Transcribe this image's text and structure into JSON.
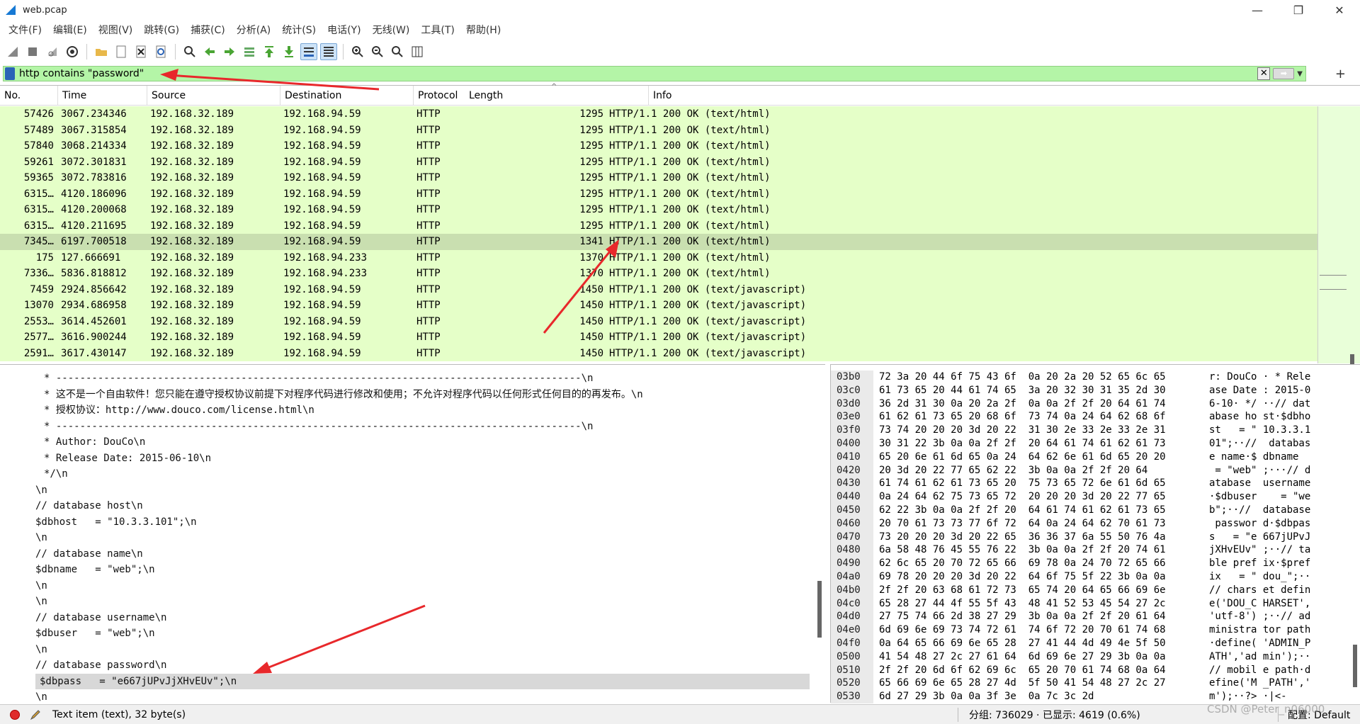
{
  "window": {
    "title": "web.pcap",
    "minimize": "—",
    "maximize": "❐",
    "close": "✕"
  },
  "menu": [
    "文件(F)",
    "编辑(E)",
    "视图(V)",
    "跳转(G)",
    "捕获(C)",
    "分析(A)",
    "统计(S)",
    "电话(Y)",
    "无线(W)",
    "工具(T)",
    "帮助(H)"
  ],
  "filter": {
    "value": "http contains \"password\""
  },
  "columns": [
    "No.",
    "Time",
    "Source",
    "Destination",
    "Protocol",
    "Length",
    "Info"
  ],
  "packets": [
    {
      "no": "57426",
      "time": "3067.234346",
      "src": "192.168.32.189",
      "dst": "192.168.94.59",
      "proto": "HTTP",
      "len": "1295",
      "info": "HTTP/1.1 200 OK  (text/html)"
    },
    {
      "no": "57489",
      "time": "3067.315854",
      "src": "192.168.32.189",
      "dst": "192.168.94.59",
      "proto": "HTTP",
      "len": "1295",
      "info": "HTTP/1.1 200 OK  (text/html)"
    },
    {
      "no": "57840",
      "time": "3068.214334",
      "src": "192.168.32.189",
      "dst": "192.168.94.59",
      "proto": "HTTP",
      "len": "1295",
      "info": "HTTP/1.1 200 OK  (text/html)"
    },
    {
      "no": "59261",
      "time": "3072.301831",
      "src": "192.168.32.189",
      "dst": "192.168.94.59",
      "proto": "HTTP",
      "len": "1295",
      "info": "HTTP/1.1 200 OK  (text/html)"
    },
    {
      "no": "59365",
      "time": "3072.783816",
      "src": "192.168.32.189",
      "dst": "192.168.94.59",
      "proto": "HTTP",
      "len": "1295",
      "info": "HTTP/1.1 200 OK  (text/html)"
    },
    {
      "no": "6315…",
      "time": "4120.186096",
      "src": "192.168.32.189",
      "dst": "192.168.94.59",
      "proto": "HTTP",
      "len": "1295",
      "info": "HTTP/1.1 200 OK  (text/html)"
    },
    {
      "no": "6315…",
      "time": "4120.200068",
      "src": "192.168.32.189",
      "dst": "192.168.94.59",
      "proto": "HTTP",
      "len": "1295",
      "info": "HTTP/1.1 200 OK  (text/html)"
    },
    {
      "no": "6315…",
      "time": "4120.211695",
      "src": "192.168.32.189",
      "dst": "192.168.94.59",
      "proto": "HTTP",
      "len": "1295",
      "info": "HTTP/1.1 200 OK  (text/html)"
    },
    {
      "no": "7345…",
      "time": "6197.700518",
      "src": "192.168.32.189",
      "dst": "192.168.94.59",
      "proto": "HTTP",
      "len": "1341",
      "info": "HTTP/1.1 200 OK  (text/html)",
      "selected": true
    },
    {
      "no": "175",
      "time": "127.666691",
      "src": "192.168.32.189",
      "dst": "192.168.94.233",
      "proto": "HTTP",
      "len": "1370",
      "info": "HTTP/1.1 200 OK  (text/html)"
    },
    {
      "no": "7336…",
      "time": "5836.818812",
      "src": "192.168.32.189",
      "dst": "192.168.94.233",
      "proto": "HTTP",
      "len": "1370",
      "info": "HTTP/1.1 200 OK  (text/html)"
    },
    {
      "no": "7459",
      "time": "2924.856642",
      "src": "192.168.32.189",
      "dst": "192.168.94.59",
      "proto": "HTTP",
      "len": "1450",
      "info": "HTTP/1.1 200 OK  (text/javascript)"
    },
    {
      "no": "13070",
      "time": "2934.686958",
      "src": "192.168.32.189",
      "dst": "192.168.94.59",
      "proto": "HTTP",
      "len": "1450",
      "info": "HTTP/1.1 200 OK  (text/javascript)"
    },
    {
      "no": "2553…",
      "time": "3614.452601",
      "src": "192.168.32.189",
      "dst": "192.168.94.59",
      "proto": "HTTP",
      "len": "1450",
      "info": "HTTP/1.1 200 OK  (text/javascript)"
    },
    {
      "no": "2577…",
      "time": "3616.900244",
      "src": "192.168.32.189",
      "dst": "192.168.94.59",
      "proto": "HTTP",
      "len": "1450",
      "info": "HTTP/1.1 200 OK  (text/javascript)"
    },
    {
      "no": "2591…",
      "time": "3617.430147",
      "src": "192.168.32.189",
      "dst": "192.168.94.59",
      "proto": "HTTP",
      "len": "1450",
      "info": "HTTP/1.1 200 OK  (text/javascript)"
    }
  ],
  "details": [
    {
      "text": "* ----------------------------------------------------------------------------------------\\n"
    },
    {
      "text": "* 这不是一个自由软件！您只能在遵守授权协议前提下对程序代码进行修改和使用；不允许对程序代码以任何形式任何目的的再发布。\\n"
    },
    {
      "text": "* 授权协议：http://www.douco.com/license.html\\n"
    },
    {
      "text": "* ----------------------------------------------------------------------------------------\\n"
    },
    {
      "text": "* Author: DouCo\\n"
    },
    {
      "text": "* Release Date: 2015-06-10\\n"
    },
    {
      "text": "*/\\n"
    },
    {
      "text": "\\n",
      "indent": true
    },
    {
      "text": "// database host\\n",
      "indent": true
    },
    {
      "text": "$dbhost   = \"10.3.3.101\";\\n",
      "indent": true
    },
    {
      "text": "\\n",
      "indent": true
    },
    {
      "text": "// database name\\n",
      "indent": true
    },
    {
      "text": "$dbname   = \"web\";\\n",
      "indent": true
    },
    {
      "text": "\\n",
      "indent": true
    },
    {
      "text": "\\n",
      "indent": true
    },
    {
      "text": "// database username\\n",
      "indent": true
    },
    {
      "text": "$dbuser   = \"web\";\\n",
      "indent": true
    },
    {
      "text": "\\n",
      "indent": true
    },
    {
      "text": "// database password\\n",
      "indent": true
    },
    {
      "text": "$dbpass   = \"e667jUPvJjXHvEUv\";\\n",
      "indent": true,
      "highlight": true
    },
    {
      "text": "\\n",
      "indent": true
    }
  ],
  "hex": [
    {
      "off": "03b0",
      "bytes": "72 3a 20 44 6f 75 43 6f  0a 20 2a 20 52 65 6c 65",
      "ascii": "r: DouCo · * Rele"
    },
    {
      "off": "03c0",
      "bytes": "61 73 65 20 44 61 74 65  3a 20 32 30 31 35 2d 30",
      "ascii": "ase Date : 2015-0"
    },
    {
      "off": "03d0",
      "bytes": "36 2d 31 30 0a 20 2a 2f  0a 0a 2f 2f 20 64 61 74",
      "ascii": "6-10· */ ··// dat"
    },
    {
      "off": "03e0",
      "bytes": "61 62 61 73 65 20 68 6f  73 74 0a 24 64 62 68 6f",
      "ascii": "abase ho st·$dbho"
    },
    {
      "off": "03f0",
      "bytes": "73 74 20 20 20 3d 20 22  31 30 2e 33 2e 33 2e 31",
      "ascii": "st   = \" 10.3.3.1"
    },
    {
      "off": "0400",
      "bytes": "30 31 22 3b 0a 0a 2f 2f  20 64 61 74 61 62 61 73",
      "ascii": "01\";··//  databas"
    },
    {
      "off": "0410",
      "bytes": "65 20 6e 61 6d 65 0a 24  64 62 6e 61 6d 65 20 20",
      "ascii": "e name·$ dbname  "
    },
    {
      "off": "0420",
      "bytes": "20 3d 20 22 77 65 62 22  3b 0a 0a 2f 2f 20 64",
      "ascii": " = \"web\" ;···// d"
    },
    {
      "off": "0430",
      "bytes": "61 74 61 62 61 73 65 20  75 73 65 72 6e 61 6d 65",
      "ascii": "atabase  username"
    },
    {
      "off": "0440",
      "bytes": "0a 24 64 62 75 73 65 72  20 20 20 3d 20 22 77 65",
      "ascii": "·$dbuser    = \"we"
    },
    {
      "off": "0450",
      "bytes": "62 22 3b 0a 0a 2f 2f 20  64 61 74 61 62 61 73 65",
      "ascii": "b\";··//  database"
    },
    {
      "off": "0460",
      "bytes": "20 70 61 73 73 77 6f 72  64 0a 24 64 62 70 61 73",
      "ascii": " passwor d·$dbpas"
    },
    {
      "off": "0470",
      "bytes": "73 20 20 20 3d 20 22 65  36 36 37 6a 55 50 76 4a",
      "ascii": "s   = \"e 667jUPvJ"
    },
    {
      "off": "0480",
      "bytes": "6a 58 48 76 45 55 76 22  3b 0a 0a 2f 2f 20 74 61",
      "ascii": "jXHvEUv\" ;··// ta"
    },
    {
      "off": "0490",
      "bytes": "62 6c 65 20 70 72 65 66  69 78 0a 24 70 72 65 66",
      "ascii": "ble pref ix·$pref"
    },
    {
      "off": "04a0",
      "bytes": "69 78 20 20 20 3d 20 22  64 6f 75 5f 22 3b 0a 0a",
      "ascii": "ix   = \" dou_\";··"
    },
    {
      "off": "04b0",
      "bytes": "2f 2f 20 63 68 61 72 73  65 74 20 64 65 66 69 6e",
      "ascii": "// chars et defin"
    },
    {
      "off": "04c0",
      "bytes": "65 28 27 44 4f 55 5f 43  48 41 52 53 45 54 27 2c",
      "ascii": "e('DOU_C HARSET',"
    },
    {
      "off": "04d0",
      "bytes": "27 75 74 66 2d 38 27 29  3b 0a 0a 2f 2f 20 61 64",
      "ascii": "'utf-8') ;··// ad"
    },
    {
      "off": "04e0",
      "bytes": "6d 69 6e 69 73 74 72 61  74 6f 72 20 70 61 74 68",
      "ascii": "ministra tor path"
    },
    {
      "off": "04f0",
      "bytes": "0a 64 65 66 69 6e 65 28  27 41 44 4d 49 4e 5f 50",
      "ascii": "·define( 'ADMIN_P"
    },
    {
      "off": "0500",
      "bytes": "41 54 48 27 2c 27 61 64  6d 69 6e 27 29 3b 0a 0a",
      "ascii": "ATH','ad min');··"
    },
    {
      "off": "0510",
      "bytes": "2f 2f 20 6d 6f 62 69 6c  65 20 70 61 74 68 0a 64",
      "ascii": "// mobil e path·d"
    },
    {
      "off": "0520",
      "bytes": "65 66 69 6e 65 28 27 4d  5f 50 41 54 48 27 2c 27",
      "ascii": "efine('M _PATH','"
    },
    {
      "off": "0530",
      "bytes": "6d 27 29 3b 0a 0a 3f 3e  0a 7c 3c 2d",
      "ascii": "m');··?> ·|<-"
    }
  ],
  "status": {
    "item": "Text item (text), 32 byte(s)",
    "packets": "分组: 736029 · 已显示: 4619 (0.6%)",
    "profile": "配置: Default"
  },
  "watermark": "CSDN @Peter_n06000"
}
